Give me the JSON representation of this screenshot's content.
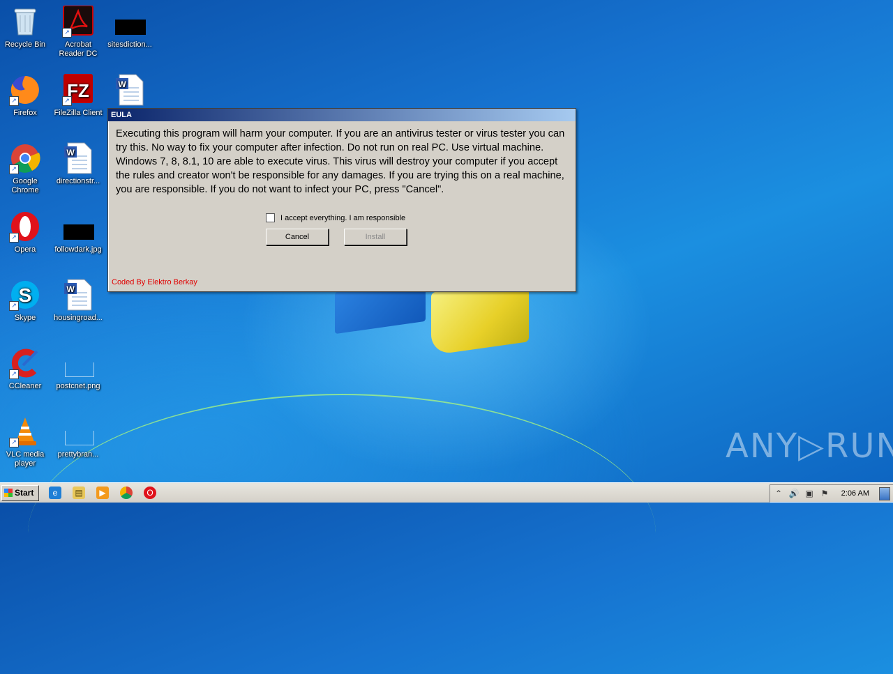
{
  "desktop": {
    "icons": [
      {
        "label": "Recycle Bin"
      },
      {
        "label": "Acrobat Reader DC"
      },
      {
        "label": "sitesdiction..."
      },
      {
        "label": "Firefox"
      },
      {
        "label": "FileZilla Client"
      },
      {
        "label": ""
      },
      {
        "label": "Google Chrome"
      },
      {
        "label": "directionstr..."
      },
      {
        "label": "Opera"
      },
      {
        "label": "followdark.jpg"
      },
      {
        "label": "Skype"
      },
      {
        "label": "housingroad..."
      },
      {
        "label": "CCleaner"
      },
      {
        "label": "postcnet.png"
      },
      {
        "label": "VLC media player"
      },
      {
        "label": "prettybran..."
      }
    ]
  },
  "dialog": {
    "title": "EULA",
    "message": "Executing this program will harm your computer. If you are an antivirus tester or virus tester you can try this. No way to fix your computer after infection. Do not run on real PC. Use virtual machine. Windows 7, 8, 8.1, 10 are able to execute virus. This virus will destroy your computer if you accept the rules and creator won't be responsible for any damages. If you are trying this on a real machine, you are responsible. If you do not want to infect your PC, press \"Cancel\".",
    "checkbox_label": "I accept everything. I am responsible",
    "checkbox_checked": false,
    "cancel_label": "Cancel",
    "install_label": "Install",
    "install_enabled": false,
    "credit": "Coded By Elektro Berkay",
    "credit_color": "#e00000"
  },
  "watermark": "ANY▷RUN",
  "taskbar": {
    "start_label": "Start",
    "clock": "2:06 AM"
  }
}
